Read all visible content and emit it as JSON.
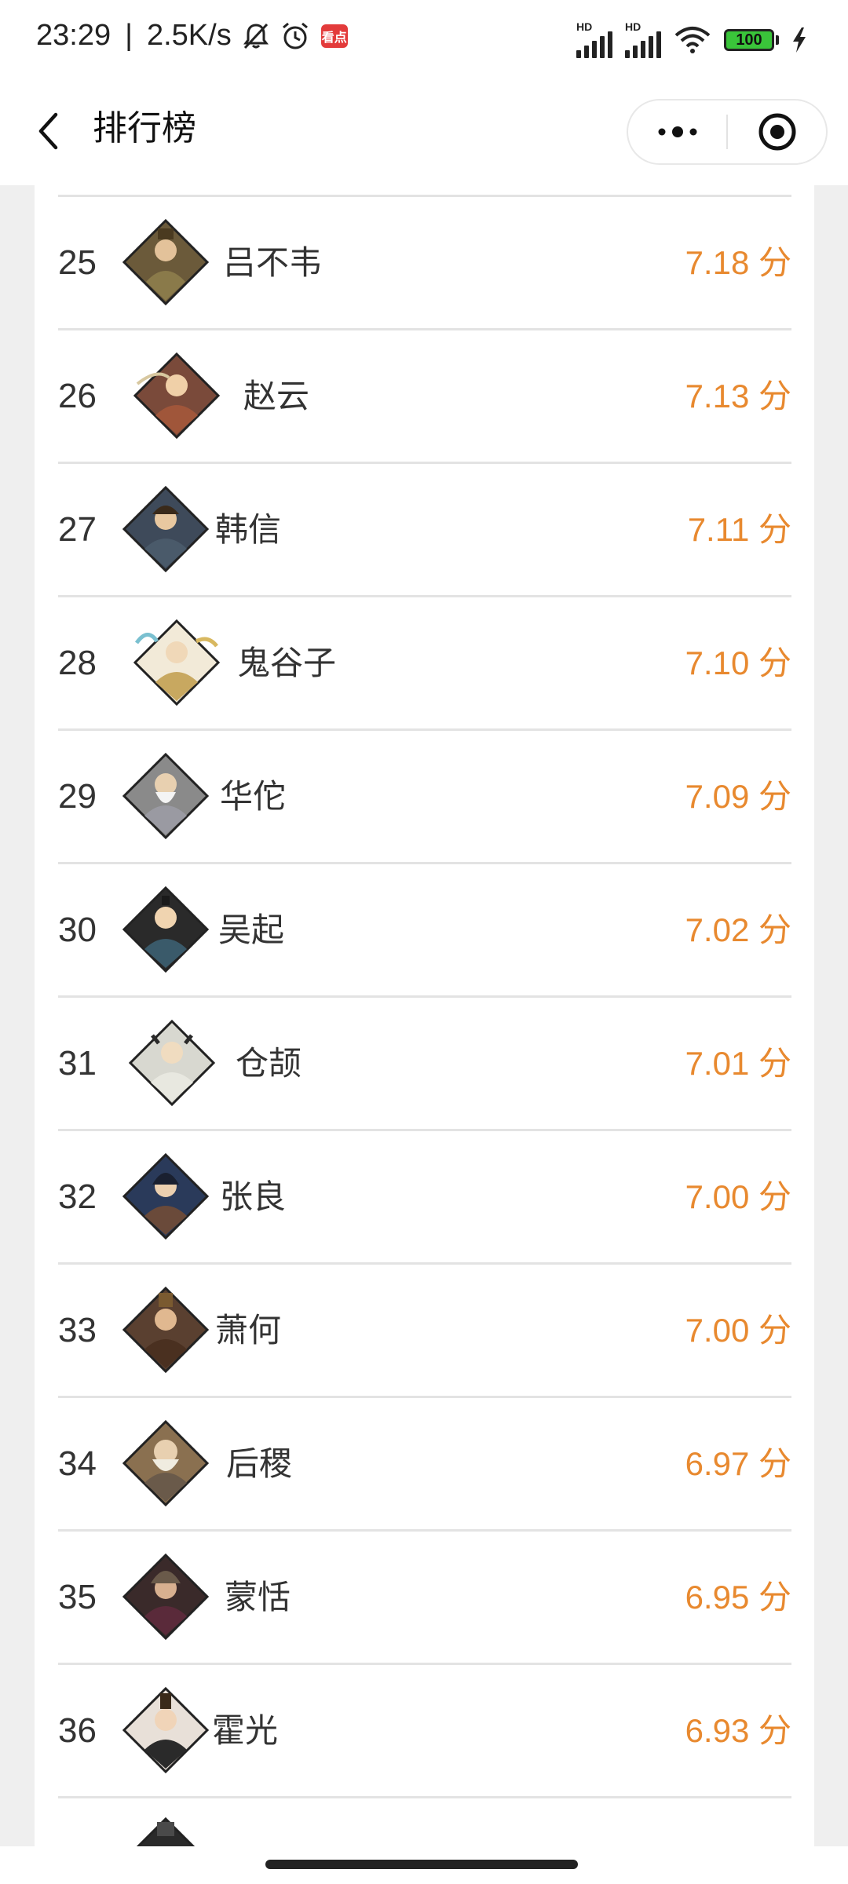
{
  "status_bar": {
    "time": "23:29",
    "separator": "|",
    "speed": "2.5K/s",
    "app_badge": "看点",
    "signal_1_label": "HD",
    "signal_2_label": "HD",
    "battery": "100"
  },
  "header": {
    "title": "排行榜"
  },
  "colors": {
    "score": "#e8892f",
    "divider": "#e3e3e3",
    "page_bg": "#efefef"
  },
  "ranking": {
    "items": [
      {
        "rank": "25",
        "name": "吕不韦",
        "score": "7.18 分",
        "avatar": "portrait-icon"
      },
      {
        "rank": "26",
        "name": "赵云",
        "score": "7.13 分",
        "avatar": "portrait-icon"
      },
      {
        "rank": "27",
        "name": "韩信",
        "score": "7.11 分",
        "avatar": "portrait-icon"
      },
      {
        "rank": "28",
        "name": "鬼谷子",
        "score": "7.10 分",
        "avatar": "portrait-icon"
      },
      {
        "rank": "29",
        "name": "华佗",
        "score": "7.09 分",
        "avatar": "portrait-icon"
      },
      {
        "rank": "30",
        "name": "吴起",
        "score": "7.02 分",
        "avatar": "portrait-icon"
      },
      {
        "rank": "31",
        "name": "仓颉",
        "score": "7.01 分",
        "avatar": "portrait-icon"
      },
      {
        "rank": "32",
        "name": "张良",
        "score": "7.00 分",
        "avatar": "portrait-icon"
      },
      {
        "rank": "33",
        "name": "萧何",
        "score": "7.00 分",
        "avatar": "portrait-icon"
      },
      {
        "rank": "34",
        "name": "后稷",
        "score": "6.97 分",
        "avatar": "portrait-icon"
      },
      {
        "rank": "35",
        "name": "蒙恬",
        "score": "6.95 分",
        "avatar": "portrait-icon"
      },
      {
        "rank": "36",
        "name": "霍光",
        "score": "6.93 分",
        "avatar": "portrait-icon"
      }
    ]
  }
}
